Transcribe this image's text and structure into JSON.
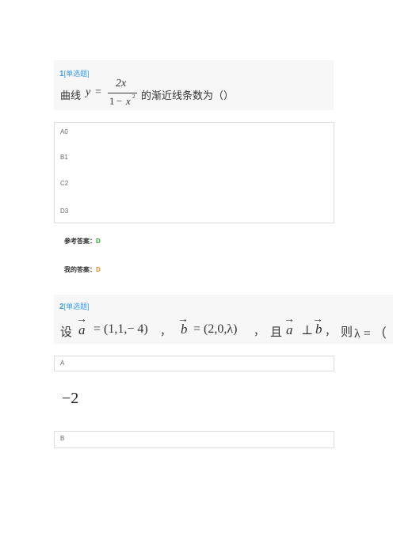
{
  "colors": {
    "tag": "#3a9be8",
    "ref_answer": "#2aa82a",
    "my_answer": "#e98a1f"
  },
  "q1": {
    "number": "1",
    "type": "[单选题]",
    "prefix": "曲线",
    "y": "y",
    "eq": "=",
    "num": "2x",
    "den_one": "1",
    "den_minus": "−",
    "den_x": "x",
    "den_exp": "2",
    "suffix": "的渐近线条数为（）",
    "options": [
      "A0",
      "B1",
      "C2",
      "D3"
    ],
    "ref_label": "参考答案：",
    "ref_value": "D",
    "my_label": "我的答案：",
    "my_value": "D"
  },
  "q2": {
    "number": "2",
    "type": "[单选题]",
    "she": "设",
    "a": "a",
    "a_val": "= (1,1,− 4)",
    "comma1": "，",
    "b": "b",
    "b_val": "= (2,0,λ)",
    "comma2": "，",
    "qie": "且",
    "a2": "a",
    "perp": "⊥",
    "b2": "b",
    "comma3": "，",
    "ze": "则",
    "lam": "λ = （",
    "option_a_label": "A",
    "option_a_value": "−2",
    "option_b_label": "B"
  }
}
